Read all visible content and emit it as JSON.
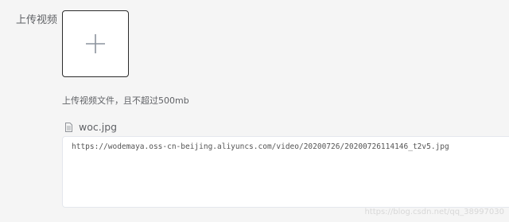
{
  "form": {
    "label": "上传视频",
    "tip": "上传视频文件，且不超过500mb"
  },
  "uploader": {
    "icon": "plus-icon"
  },
  "file": {
    "icon": "document-icon",
    "name": "woc.jpg"
  },
  "url_box": {
    "value": "https://wodemaya.oss-cn-beijing.aliyuncs.com/video/20200726/20200726114146_t2v5.jpg"
  },
  "watermark": {
    "text": "https://blog.csdn.net/qq_38997030"
  },
  "colors": {
    "background": "#f5f5f5",
    "uploader_border": "#2b2b2b",
    "text": "#606266"
  }
}
